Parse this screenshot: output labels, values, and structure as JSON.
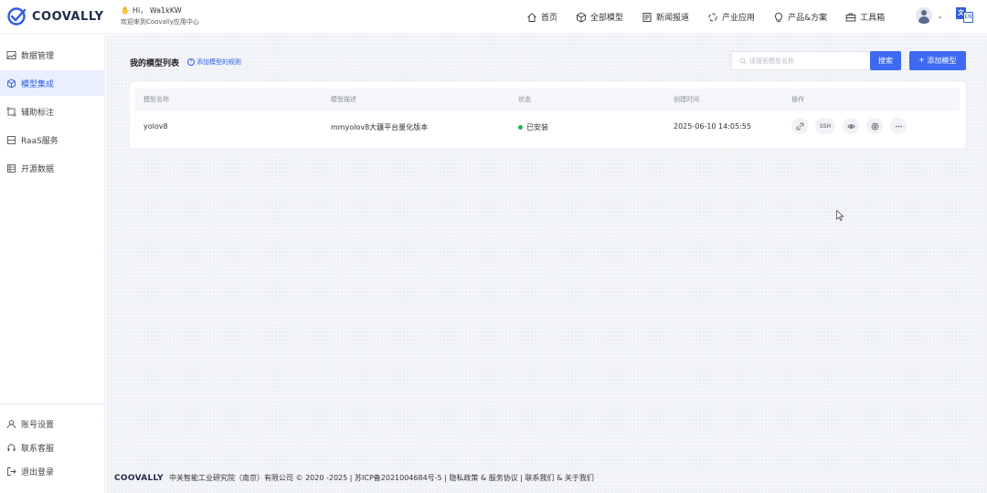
{
  "header": {
    "brand": "COOVALLY",
    "greeting": "Hi， Wa1kKW",
    "greeting_sub": "欢迎来到Coovally应用中心",
    "nav": [
      {
        "label": "首页",
        "icon": "home-icon"
      },
      {
        "label": "全部模型",
        "icon": "cube-icon"
      },
      {
        "label": "新闻报道",
        "icon": "news-icon"
      },
      {
        "label": "产业应用",
        "icon": "industry-icon"
      },
      {
        "label": "产品&方案",
        "icon": "bulb-icon"
      },
      {
        "label": "工具箱",
        "icon": "toolbox-icon"
      }
    ],
    "lang_a": "文",
    "lang_b": "EN"
  },
  "sidebar": {
    "items": [
      {
        "label": "数据管理",
        "icon": "image-icon",
        "active": false
      },
      {
        "label": "模型集成",
        "icon": "cube-icon",
        "active": true
      },
      {
        "label": "辅助标注",
        "icon": "annotate-icon",
        "active": false
      },
      {
        "label": "RaaS服务",
        "icon": "server-icon",
        "active": false
      },
      {
        "label": "开源数据",
        "icon": "dataset-icon",
        "active": false
      }
    ],
    "bottom": [
      {
        "label": "账号设置",
        "icon": "user-icon"
      },
      {
        "label": "联系客服",
        "icon": "headset-icon"
      },
      {
        "label": "退出登录",
        "icon": "logout-icon"
      }
    ]
  },
  "main": {
    "title": "我的模型列表",
    "rule_link": "添加模型的规则",
    "search_placeholder": "请搜索模型名称",
    "search_button": "搜索",
    "add_button": "添加模型",
    "table": {
      "headers": [
        "模型名称",
        "模型描述",
        "状态",
        "创建时间",
        "操作"
      ],
      "rows": [
        {
          "name": "yolov8",
          "description": "mmyolov8大疆平台量化版本",
          "status": "已安装",
          "created": "2025-06-10 14:05:55",
          "ops": [
            "link-icon",
            "SSH",
            "eye-icon",
            "settings-icon",
            "more-icon"
          ]
        }
      ]
    }
  },
  "footer": {
    "brand": "COOVALLY",
    "text": "中关智能工业研究院（南京）有限公司 © 2020 -2025 | 苏ICP备2021004684号-5 | 隐私政策 & 服务协议 | 联系我们  &  关于我们"
  },
  "colors": {
    "accent": "#3d6af0",
    "active_bg": "#e9efff",
    "status_ok": "#22b35e"
  }
}
